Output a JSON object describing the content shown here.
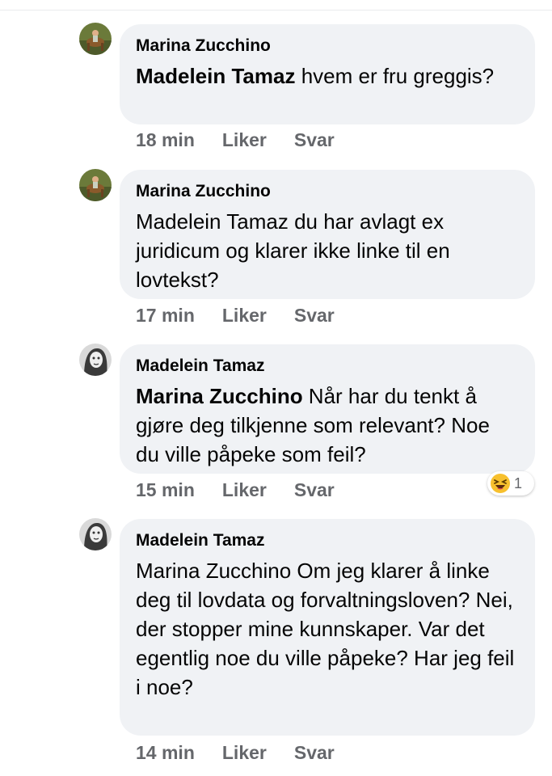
{
  "comments": [
    {
      "author": "Marina Zucchino",
      "mention": "Madelein Tamaz",
      "text": " hvem er fru greggis?",
      "time": "18 min",
      "like_label": "Liker",
      "reply_label": "Svar"
    },
    {
      "author": "Marina Zucchino",
      "mention": "",
      "text": "Madelein Tamaz du har avlagt ex juridicum og klarer ikke linke til en lovtekst?",
      "time": "17 min",
      "like_label": "Liker",
      "reply_label": "Svar"
    },
    {
      "author": "Madelein Tamaz",
      "mention": "Marina Zucchino",
      "text": " Når har du tenkt å gjøre deg tilkjenne som relevant? Noe du ville påpeke som feil?",
      "time": "15 min",
      "like_label": "Liker",
      "reply_label": "Svar",
      "reaction": {
        "icon": "laughing-emoji-icon",
        "count": "1"
      }
    },
    {
      "author": "Madelein Tamaz",
      "mention": "",
      "text": "Marina Zucchino Om jeg klarer å linke deg til lovdata og forvaltningsloven? Nei, der stopper mine kunnskaper. Var det egentlig noe du ville påpeke? Har jeg feil i noe?",
      "time": "14 min",
      "like_label": "Liker",
      "reply_label": "Svar"
    }
  ],
  "colors": {
    "bubble": "#f0f2f5",
    "meta_text": "#65676b",
    "primary_text": "#050505"
  }
}
